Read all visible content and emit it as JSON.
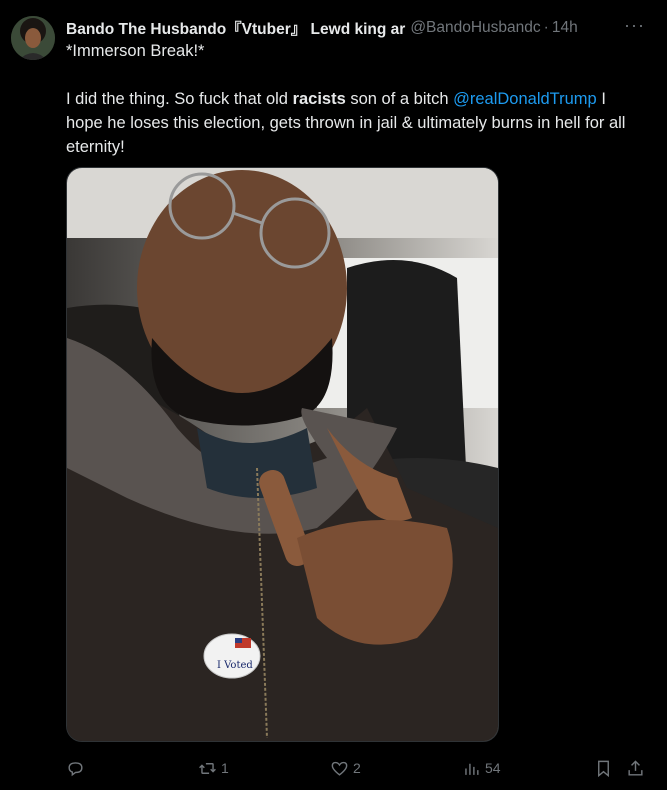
{
  "tweet": {
    "display_name": "Bando The Husbando『Vtuber』 Lewd king ar",
    "handle": "@BandoHusbandc",
    "separator": "·",
    "time": "14h",
    "more_label": "···",
    "line1": "*Immerson Break!*",
    "text_a": "I did the thing. So fuck that old ",
    "text_bold": "racists",
    "text_b": " son of a bitch ",
    "mention": "@realDonaldTrump",
    "text_c": " I hope he loses this election, gets thrown in jail & ultimately burns in hell for all eternity!"
  },
  "media": {
    "sticker_text": "I Voted"
  },
  "actions": {
    "replies": "",
    "reposts": "1",
    "likes": "2",
    "views": "54"
  },
  "icons": {
    "reply": "reply-icon",
    "repost": "repost-icon",
    "like": "heart-icon",
    "views": "views-icon",
    "bookmark": "bookmark-icon",
    "share": "share-icon"
  },
  "colors": {
    "accent": "#1d9bf0",
    "muted": "#71767b",
    "text": "#e7e9ea"
  }
}
